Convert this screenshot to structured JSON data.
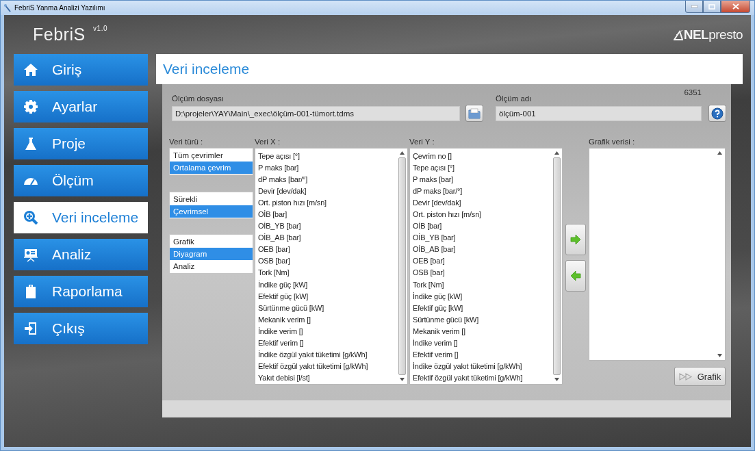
{
  "window": {
    "title": "FebriS Yanma Analizi Yazılımı"
  },
  "header": {
    "app_name": "FebriS $^{v1.0}$",
    "logo": "**NEL**presto"
  },
  "sidebar": {
    "items": [
      {
        "label": "Giriş",
        "selected": false
      },
      {
        "label": "Ayarlar",
        "selected": false
      },
      {
        "label": "Proje",
        "selected": false
      },
      {
        "label": "Ölçüm",
        "selected": false
      },
      {
        "label": "Veri inceleme",
        "selected": true
      },
      {
        "label": "Analiz",
        "selected": false
      },
      {
        "label": "Raporlama",
        "selected": false
      },
      {
        "label": "Çıkış",
        "selected": false
      }
    ]
  },
  "page": {
    "title": "Veri inceleme"
  },
  "file_field": {
    "label": "Ölçüm dosyası",
    "value": "D:\\projeler\\YAY\\Main\\_exec\\ölçüm-001-tümort.tdms"
  },
  "name_field": {
    "label": "Ölçüm adı",
    "value": "ölçüm-001",
    "count": "6351"
  },
  "data_type": {
    "label": "Veri türü :",
    "groups": [
      [
        {
          "label": "Tüm çevrimler",
          "selected": false
        },
        {
          "label": "Ortalama çevrim",
          "selected": true
        }
      ],
      [
        {
          "label": "Sürekli",
          "selected": false
        },
        {
          "label": "Çevrimsel",
          "selected": true
        }
      ],
      [
        {
          "label": "Grafik",
          "selected": false
        },
        {
          "label": "Diyagram",
          "selected": true
        },
        {
          "label": "Analiz",
          "selected": false
        }
      ]
    ]
  },
  "x_list": {
    "label": "Veri X :",
    "items": [
      "Tepe açısı [°]",
      "P maks [bar]",
      "dP maks [bar/°]",
      "Devir [dev/dak]",
      "Ort. piston hızı [m/sn]",
      "OİB [bar]",
      "OİB_YB [bar]",
      "OİB_AB [bar]",
      "OEB [bar]",
      "OSB [bar]",
      "Tork [Nm]",
      "İndike güç [kW]",
      "Efektif güç [kW]",
      "Sürtünme gücü [kW]",
      "Mekanik verim []",
      "İndike verim []",
      "Efektif verim []",
      "İndike özgül yakıt tüketimi [g/kWh]",
      "Efektif özgül yakıt tüketimi [g/kWh]",
      "Yakıt debisi [l/st]"
    ]
  },
  "y_list": {
    "label": "Veri Y :",
    "items": [
      "Çevrim no []",
      "Tepe açısı [°]",
      "P maks [bar]",
      "dP maks [bar/°]",
      "Devir [dev/dak]",
      "Ort. piston hızı [m/sn]",
      "OİB [bar]",
      "OİB_YB [bar]",
      "OİB_AB [bar]",
      "OEB [bar]",
      "OSB [bar]",
      "Tork [Nm]",
      "İndike güç [kW]",
      "Efektif güç [kW]",
      "Sürtünme gücü [kW]",
      "Mekanik verim []",
      "İndike verim []",
      "Efektif verim []",
      "İndike özgül yakıt tüketimi [g/kWh]",
      "Efektif özgül yakıt tüketimi [g/kWh]"
    ]
  },
  "graph_data": {
    "label": "Grafik verisi :"
  },
  "graph_button": {
    "label": "Grafik"
  }
}
